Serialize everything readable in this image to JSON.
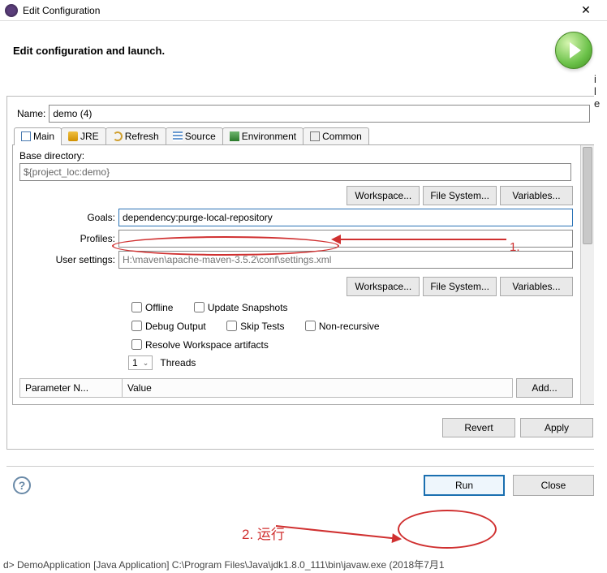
{
  "window": {
    "title": "Edit Configuration",
    "close": "✕"
  },
  "banner": {
    "title": "Edit configuration and launch."
  },
  "name": {
    "label": "Name:",
    "value": "demo (4)"
  },
  "tabs": {
    "main": "Main",
    "jre": "JRE",
    "refresh": "Refresh",
    "source": "Source",
    "environment": "Environment",
    "common": "Common"
  },
  "basedir": {
    "label": "Base directory:",
    "value": "${project_loc:demo}"
  },
  "buttons": {
    "workspace": "Workspace...",
    "filesystem": "File System...",
    "variables": "Variables...",
    "add": "Add...",
    "revert": "Revert",
    "apply": "Apply",
    "run": "Run",
    "close": "Close"
  },
  "goals": {
    "label": "Goals:",
    "value": "dependency:purge-local-repository"
  },
  "profiles": {
    "label": "Profiles:",
    "value": ""
  },
  "usersettings": {
    "label": "User settings:",
    "value": "H:\\maven\\apache-maven-3.5.2\\conf\\settings.xml",
    "placeholder": "H:\\maven\\apache-maven-3.5.2\\conf\\settings.xml"
  },
  "checks": {
    "offline": "Offline",
    "update": "Update Snapshots",
    "debug": "Debug Output",
    "skip": "Skip Tests",
    "nonrec": "Non-recursive",
    "resolve": "Resolve Workspace artifacts"
  },
  "threads": {
    "value": "1",
    "label": "Threads"
  },
  "param": {
    "name_header": "Parameter N...",
    "value_header": "Value"
  },
  "annot": {
    "one": "1.",
    "two": "2. 运行"
  },
  "status": "d> DemoApplication [Java Application] C:\\Program Files\\Java\\jdk1.8.0_111\\bin\\javaw.exe (2018年7月1"
}
